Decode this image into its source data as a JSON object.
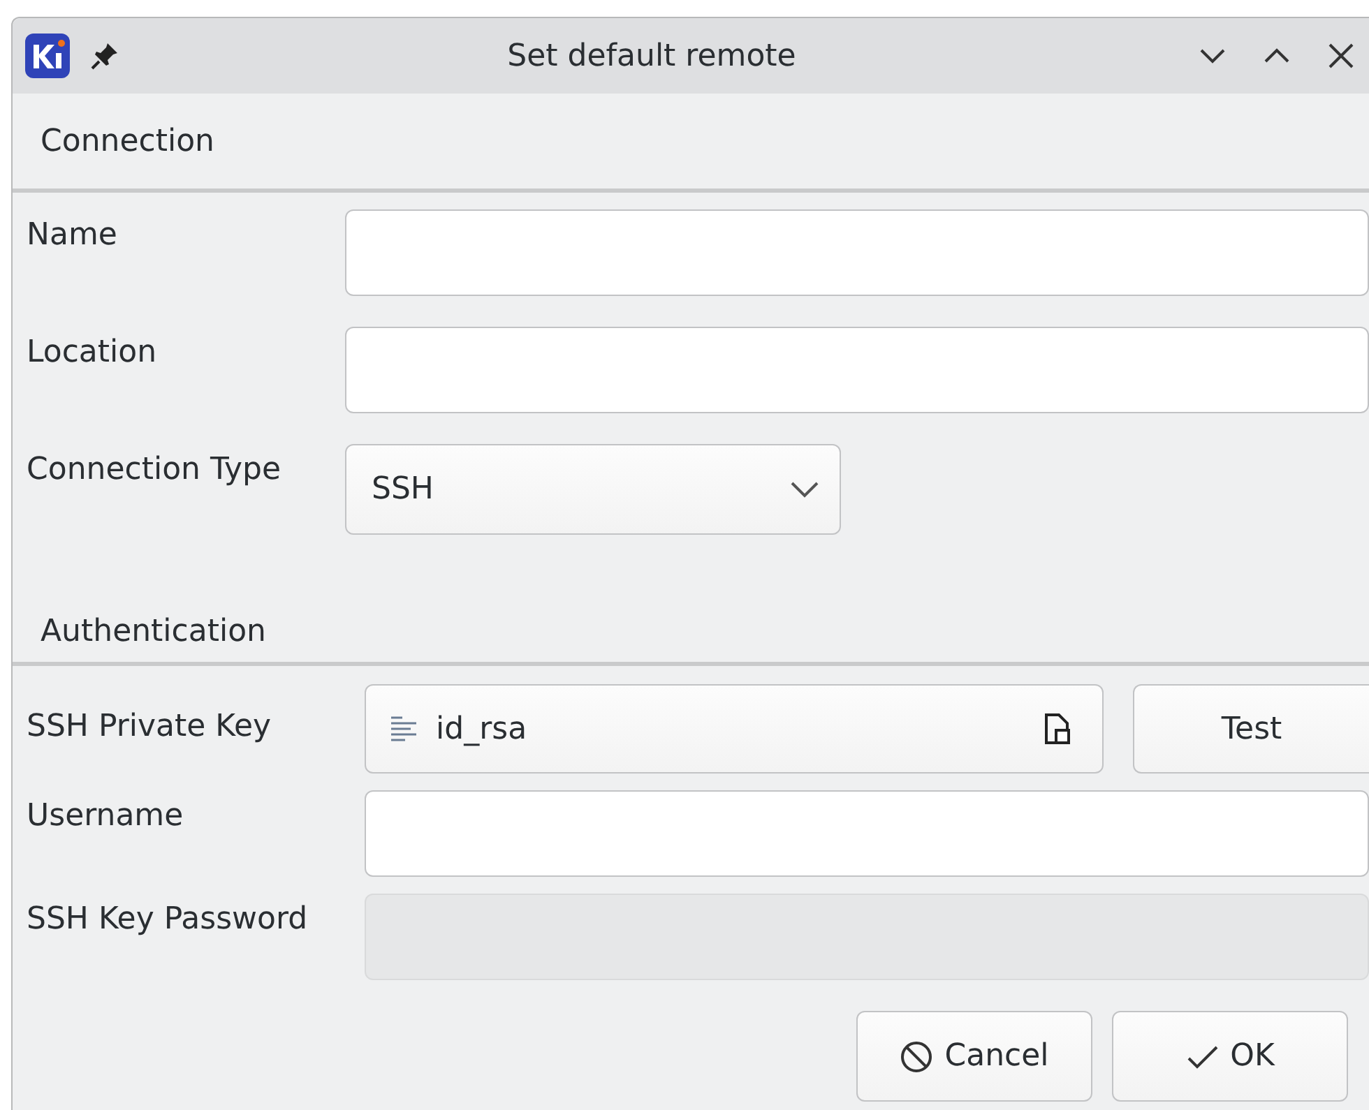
{
  "window": {
    "title": "Set default remote"
  },
  "sections": [
    {
      "heading": "Connection",
      "fields": [
        {
          "kind": "text",
          "label": "Name",
          "disabled": false
        },
        {
          "kind": "text",
          "label": "Location",
          "disabled": false
        },
        {
          "kind": "select",
          "label": "Connection Type",
          "value": "SSH"
        }
      ]
    },
    {
      "heading": "Authentication",
      "fields": [
        {
          "kind": "file",
          "label": "SSH Private Key",
          "value": "id_rsa",
          "button": "Test"
        },
        {
          "kind": "text",
          "label": "Username",
          "disabled": false
        },
        {
          "kind": "text",
          "label": "SSH Key Password",
          "disabled": true
        }
      ]
    }
  ],
  "buttons": [
    {
      "kind": "cancel",
      "label": "Cancel"
    },
    {
      "kind": "ok",
      "label": "OK"
    }
  ]
}
